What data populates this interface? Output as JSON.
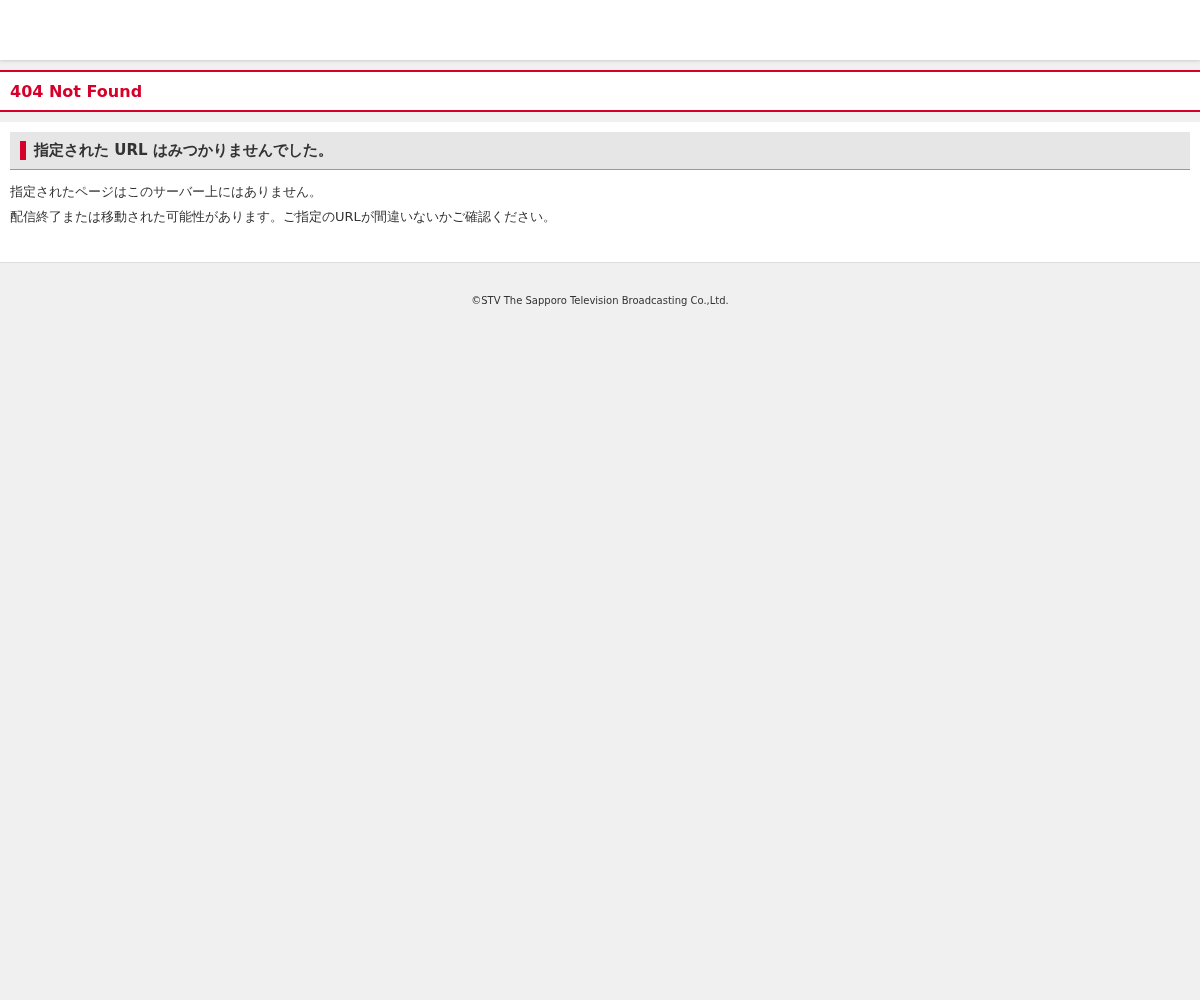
{
  "page_title": "404 Not Found",
  "message": {
    "heading": "指定された URL はみつかりませんでした。",
    "lines": [
      "指定されたページはこのサーバー上にはありません。",
      "配信終了または移動された可能性があります。ご指定のURLが間違いないかご確認ください。"
    ]
  },
  "footer": {
    "copyright": "©STV The Sapporo Television Broadcasting Co.,Ltd."
  }
}
